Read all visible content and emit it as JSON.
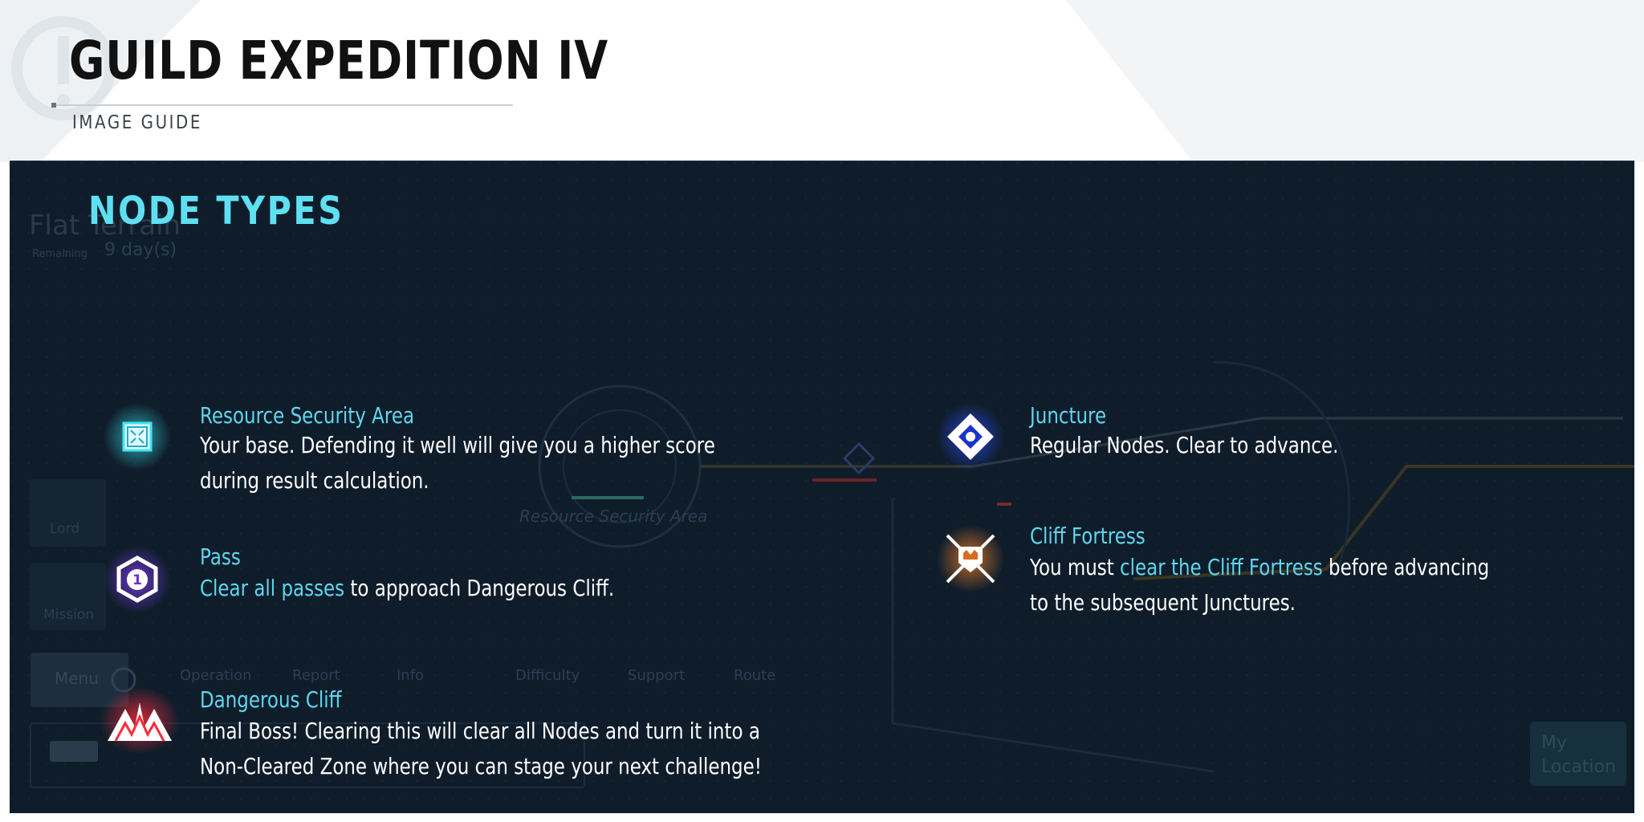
{
  "header": {
    "title": "GUILD EXPEDITION IV",
    "subtitle": "IMAGE GUIDE"
  },
  "section": {
    "heading": "NODE TYPES"
  },
  "nodes": {
    "resource": {
      "icon": "resource-security-area-icon",
      "name": "Resource Security Area",
      "desc": "Your base. Defending it well will give you a higher score during result calculation."
    },
    "pass": {
      "icon": "pass-icon",
      "badge_number": "1",
      "name": "Pass",
      "desc_highlight": "Clear all passes",
      "desc_rest": " to approach Dangerous Cliff."
    },
    "cliff": {
      "icon": "dangerous-cliff-icon",
      "name": "Dangerous Cliff",
      "desc": "Final Boss! Clearing this will clear all Nodes and turn it into a Non-Cleared Zone where you can stage your next challenge!"
    },
    "juncture": {
      "icon": "juncture-icon",
      "name": "Juncture",
      "desc": "Regular Nodes. Clear to advance."
    },
    "fortress": {
      "icon": "cliff-fortress-icon",
      "name": "Cliff Fortress",
      "desc_pre": "You must ",
      "desc_highlight": "clear the Cliff Fortress",
      "desc_post": " before advancing to the subsequent Junctures."
    }
  },
  "background": {
    "terrain_name": "Flat Terrain",
    "remaining_label": "Remaining",
    "remaining_value": "9 day(s)",
    "side_menu": [
      "Lord",
      "Mission"
    ],
    "menu_button": "Menu",
    "toolbar": [
      "Operation",
      "Report",
      "Info",
      "Difficulty",
      "Support",
      "Route"
    ],
    "map_node_label": "Resource Security Area",
    "my_location": [
      "My",
      "Location"
    ]
  },
  "colors": {
    "panel": "#0f1d2b",
    "heading": "#5fe0f2",
    "node_name": "#5fd6ee",
    "resource_icon": "#3ee6f0",
    "pass_icon": "#8a3cff",
    "cliff_icon": "#ff2a3a",
    "juncture_icon": "#2a4dff",
    "fortress_icon": "#e07a2a"
  }
}
